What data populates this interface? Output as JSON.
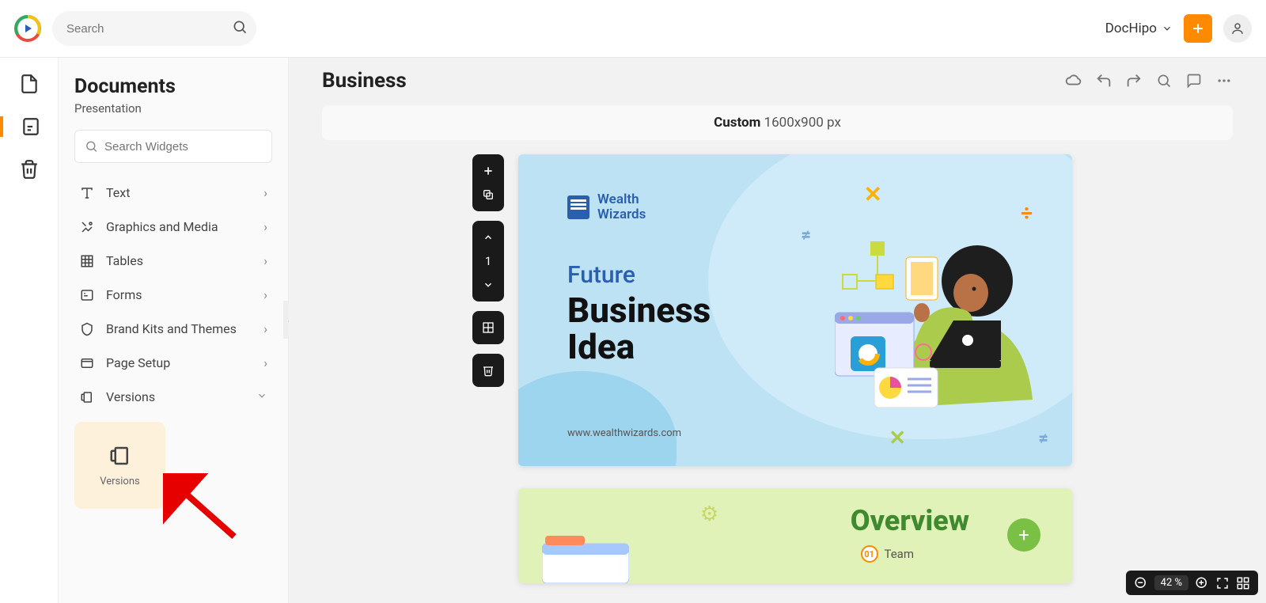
{
  "top": {
    "search_placeholder": "Search",
    "brand": "DocHipo"
  },
  "sidebar": {
    "title": "Documents",
    "subtitle": "Presentation",
    "widget_search_placeholder": "Search Widgets",
    "items": [
      {
        "label": "Text",
        "icon": "text"
      },
      {
        "label": "Graphics and Media",
        "icon": "media"
      },
      {
        "label": "Tables",
        "icon": "table"
      },
      {
        "label": "Forms",
        "icon": "form"
      },
      {
        "label": "Brand Kits and Themes",
        "icon": "brand"
      },
      {
        "label": "Page Setup",
        "icon": "page"
      },
      {
        "label": "Versions",
        "icon": "versions",
        "expanded": true
      }
    ],
    "versions_card_label": "Versions"
  },
  "canvas": {
    "title": "Business",
    "dims_label": "Custom",
    "dims_value": "1600x900 px",
    "page_number": "1",
    "zoom": "42 %",
    "slide1": {
      "brand": "Wealth\nWizards",
      "line1": "Future",
      "line2": "Business\nIdea",
      "url": "www.wealthwizards.com"
    },
    "slide2": {
      "title": "Overview",
      "sub_num": "01",
      "sub_label": "Team"
    }
  }
}
